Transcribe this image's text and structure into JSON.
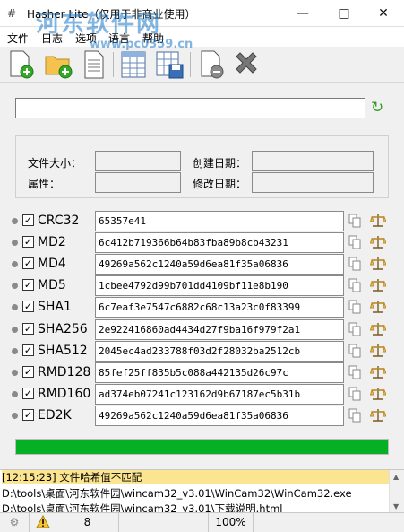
{
  "window": {
    "title": "Hasher Lite（仅用于非商业使用）"
  },
  "menu": {
    "items": [
      "文件",
      "日志",
      "选项",
      "语言",
      "帮助"
    ]
  },
  "watermark": {
    "text": "河东软件网",
    "url": "www.pc0359.cn"
  },
  "file_path": {
    "value": ""
  },
  "info": {
    "size_label": "文件大小：",
    "created_label": "创建日期：",
    "attr_label": "属性：",
    "modified_label": "修改日期："
  },
  "hashes": [
    {
      "name": "CRC32",
      "value": "65357e41",
      "checked": true
    },
    {
      "name": "MD2",
      "value": "6c412b719366b64b83fba89b8cb43231",
      "checked": true
    },
    {
      "name": "MD4",
      "value": "49269a562c1240a59d6ea81f35a06836",
      "checked": true
    },
    {
      "name": "MD5",
      "value": "1cbee4792d99b701dd4109bf11e8b190",
      "checked": true
    },
    {
      "name": "SHA1",
      "value": "6c7eaf3e7547c6882c68c13a23c0f83399",
      "checked": true
    },
    {
      "name": "SHA256",
      "value": "2e922416860ad4434d27f9ba16f979f2a1",
      "checked": true
    },
    {
      "name": "SHA512",
      "value": "2045ec4ad233788f03d2f28032ba2512cb",
      "checked": true
    },
    {
      "name": "RMD128",
      "value": "85fef25ff835b5c088a442135d26c97c",
      "checked": true
    },
    {
      "name": "RMD160",
      "value": "ad374eb07241c123162d9b67187ec5b31b",
      "checked": true
    },
    {
      "name": "ED2K",
      "value": "49269a562c1240a59d6ea81f35a06836",
      "checked": true
    }
  ],
  "progress": {
    "fraction": 1.0
  },
  "log": {
    "lines": [
      "[12:15:23] 文件哈希值不匹配",
      "D:\\tools\\桌面\\河东软件园\\wincam32_v3.01\\WinCam32\\WinCam32.exe",
      "D:\\tools\\桌面\\河东软件园\\wincam32_v3.01\\下载说明.html"
    ]
  },
  "status": {
    "count": "8",
    "zoom": "100%"
  },
  "colors": {
    "progress": "#06b025",
    "log_highlight": "#fbe590"
  }
}
